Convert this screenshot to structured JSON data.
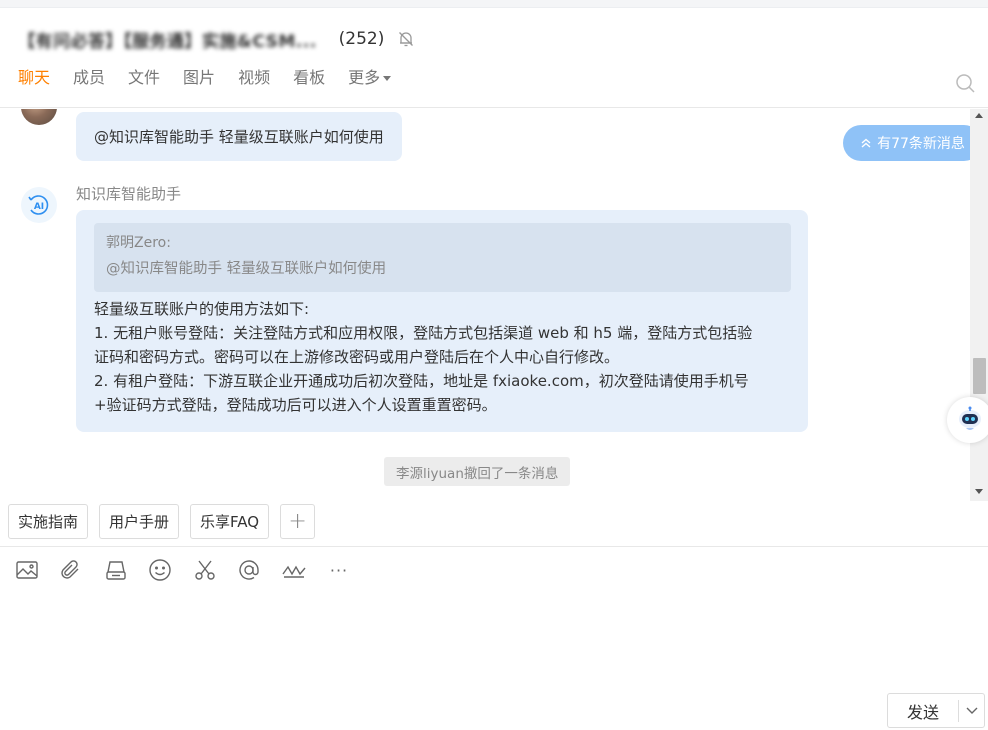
{
  "header": {
    "group_name": "【有问必答】【服务通】实施&CSM...",
    "member_count": "(252)",
    "tabs": [
      {
        "label": "聊天",
        "active": true
      },
      {
        "label": "成员",
        "active": false
      },
      {
        "label": "文件",
        "active": false
      },
      {
        "label": "图片",
        "active": false
      },
      {
        "label": "视频",
        "active": false
      },
      {
        "label": "看板",
        "active": false
      },
      {
        "label": "更多",
        "active": false
      }
    ]
  },
  "messages": {
    "user_bubble": "@知识库智能助手 轻量级互联账户如何使用",
    "new_messages_badge": "有77条新消息",
    "ai_name": "知识库智能助手",
    "ai_avatar_label": "AI",
    "quote_author": "郭明Zero:",
    "quote_text": "@知识库智能助手 轻量级互联账户如何使用",
    "ai_lines": [
      "轻量级互联账户的使用方法如下:",
      "1. 无租户账号登陆：关注登陆方式和应用权限，登陆方式包括渠道 web 和 h5 端，登陆方式包括验",
      "证码和密码方式。密码可以在上游修改密码或用户登陆后在个人中心自行修改。",
      "2. 有租户登陆：下游互联企业开通成功后初次登陆，地址是 fxiaoke.com，初次登陆请使用手机号",
      "+验证码方式登陆，登陆成功后可以进入个人设置重置密码。"
    ],
    "recall_notice": "李源liyuan撤回了一条消息"
  },
  "shortcuts": [
    "实施指南",
    "用户手册",
    "乐享FAQ"
  ],
  "shortcut_add": "+",
  "toolbar": {
    "more_glyph": "···"
  },
  "composer": {
    "send_label": "发送"
  },
  "colors": {
    "accent": "#ff8000",
    "bubble": "#e6effa",
    "quote": "#d7e2ef",
    "badge": "#8fc2f7"
  }
}
